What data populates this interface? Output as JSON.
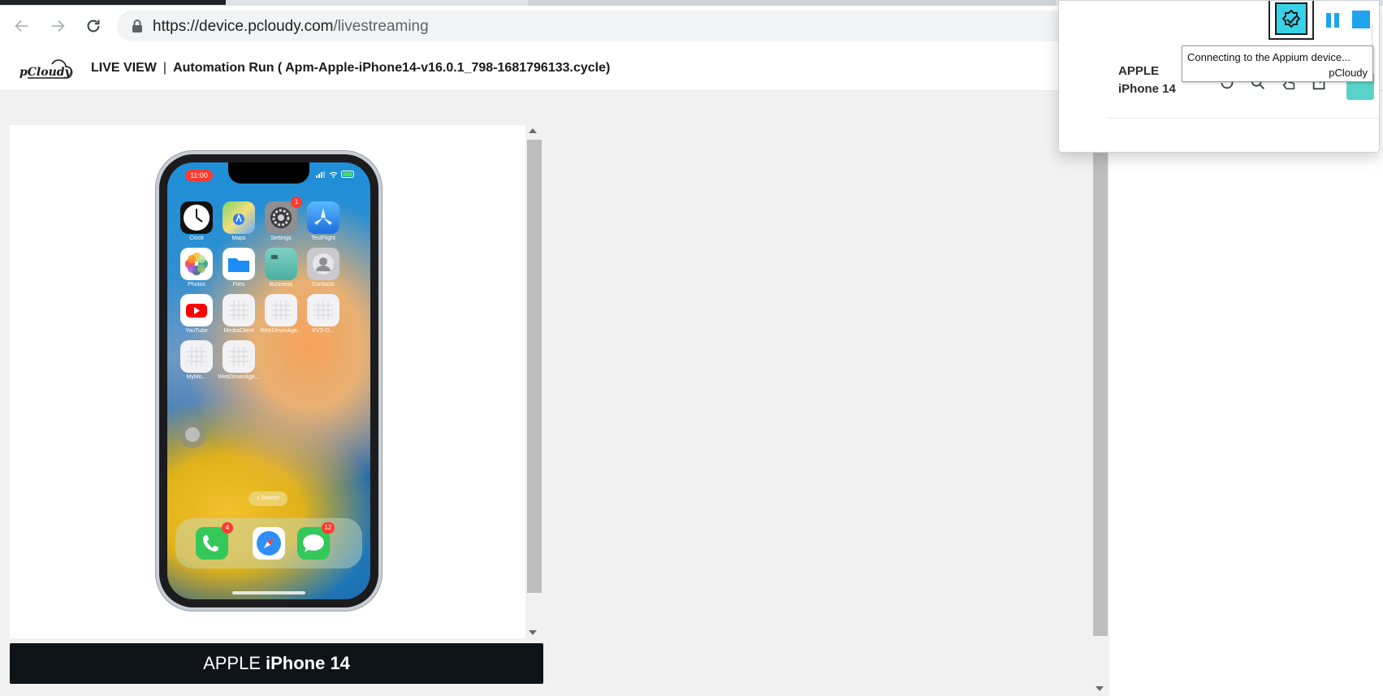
{
  "browser": {
    "url_host": "https://device.pcloudy.com",
    "url_path": "/livestreaming"
  },
  "header": {
    "logo_text": "pCloudy",
    "live_view": "LIVE VIEW",
    "separator": "|",
    "run_title": "Automation Run ( Apm-Apple-iPhone14-v16.0.1_798-1681796133.cycle)"
  },
  "device": {
    "brand": "APPLE",
    "model": "iPhone 14",
    "status_time": "11:00",
    "apps": [
      {
        "label": "Clock"
      },
      {
        "label": "Maps"
      },
      {
        "label": "Settings",
        "badge": "1"
      },
      {
        "label": "TestFlight"
      },
      {
        "label": "Photos"
      },
      {
        "label": "Files"
      },
      {
        "label": "Business"
      },
      {
        "label": "Contacts"
      },
      {
        "label": "YouTube"
      },
      {
        "label": "MediaClient"
      },
      {
        "label": "WebDriverAge..."
      },
      {
        "label": "KVS-D..."
      },
      {
        "label": "MyMo..."
      },
      {
        "label": "WebDriverAge..."
      }
    ],
    "search_label": "Search",
    "dock": [
      {
        "name": "Phone",
        "badge": "4"
      },
      {
        "name": "Safari"
      },
      {
        "name": "Messages",
        "badge": "12"
      }
    ]
  },
  "extension_popup": {
    "brand": "APPLE",
    "model": "iPhone 14",
    "tooltip_line1": "Connecting to the Appium device...",
    "tooltip_line2": "pCloudy"
  },
  "colors": {
    "accent_cyan": "#38d2e8",
    "stop_blue": "#1fa3ef",
    "device_label_bg": "#0f1419"
  }
}
